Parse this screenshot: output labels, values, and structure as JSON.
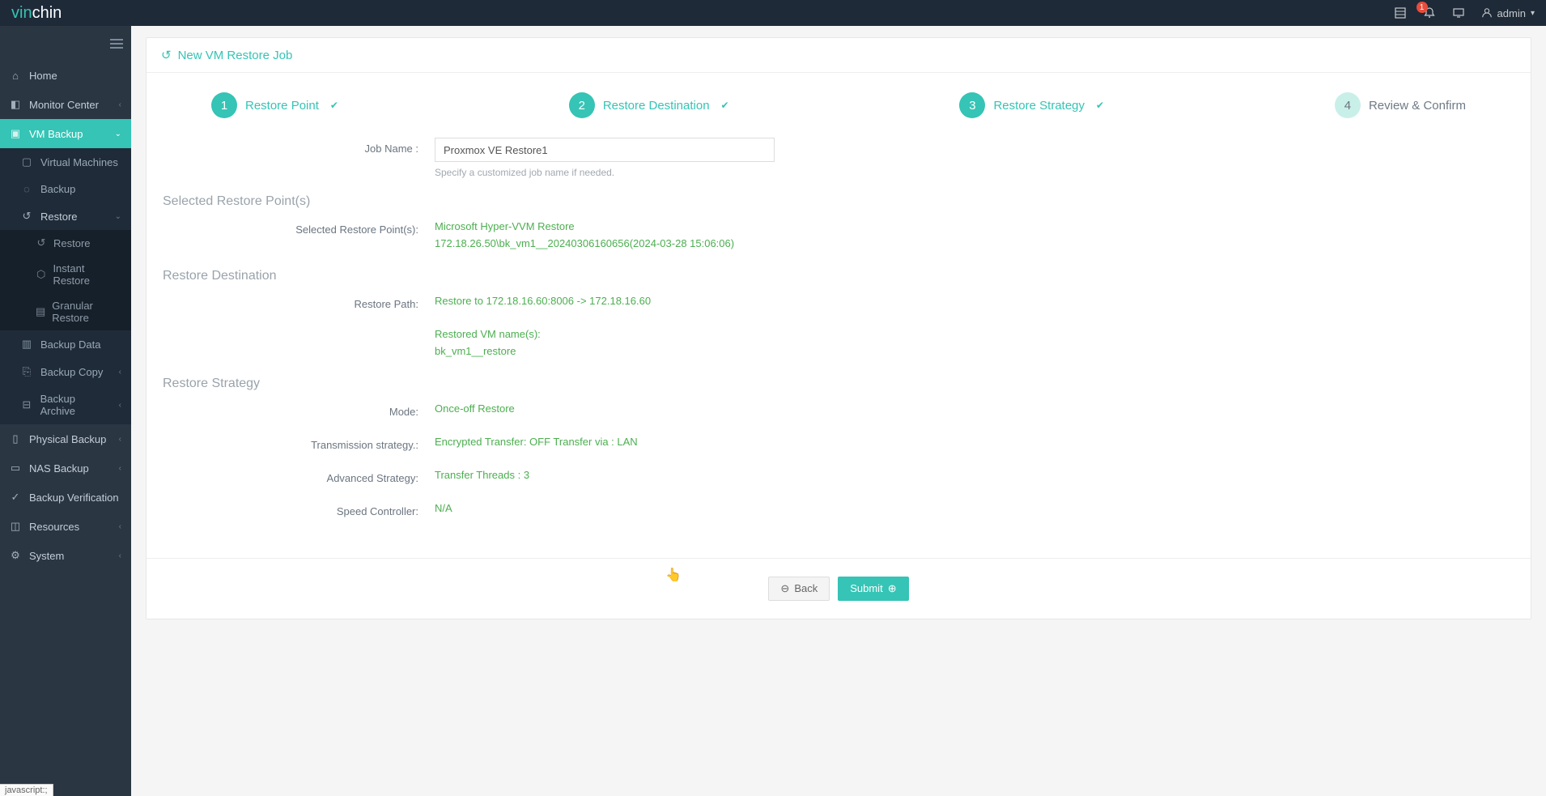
{
  "topbar": {
    "logo_part1": "vin",
    "logo_part2": "chin",
    "notif_count": "1",
    "user_label": "admin"
  },
  "sidebar": {
    "items": [
      {
        "label": "Home"
      },
      {
        "label": "Monitor Center"
      },
      {
        "label": "VM Backup",
        "active": true
      },
      {
        "label": "Physical Backup"
      },
      {
        "label": "NAS Backup"
      },
      {
        "label": "Backup Verification"
      },
      {
        "label": "Resources"
      },
      {
        "label": "System"
      }
    ],
    "vmbackup_sub": [
      {
        "label": "Virtual Machines"
      },
      {
        "label": "Backup"
      },
      {
        "label": "Restore",
        "expanded": true
      },
      {
        "label": "Backup Data"
      },
      {
        "label": "Backup Copy"
      },
      {
        "label": "Backup Archive"
      }
    ],
    "restore_sub": [
      {
        "label": "Restore"
      },
      {
        "label": "Instant Restore"
      },
      {
        "label": "Granular Restore"
      }
    ]
  },
  "page": {
    "title": "New VM Restore Job",
    "steps": [
      {
        "num": "1",
        "label": "Restore Point"
      },
      {
        "num": "2",
        "label": "Restore Destination"
      },
      {
        "num": "3",
        "label": "Restore Strategy"
      },
      {
        "num": "4",
        "label": "Review & Confirm"
      }
    ],
    "job_name_label": "Job Name :",
    "job_name_value": "Proxmox VE Restore1",
    "job_name_helper": "Specify a customized job name if needed.",
    "section_restore_points": "Selected Restore Point(s)",
    "selected_restore_points_label": "Selected Restore Point(s):",
    "selected_restore_points_val1": "Microsoft Hyper-VVM Restore",
    "selected_restore_points_val2": "172.18.26.50\\bk_vm1__20240306160656(2024-03-28 15:06:06)",
    "section_restore_dest": "Restore Destination",
    "restore_path_label": "Restore Path:",
    "restore_path_val": "Restore to 172.18.16.60:8006 -> 172.18.16.60",
    "restored_vm_names_label": "Restored VM name(s):",
    "restored_vm_names_val": "bk_vm1__restore",
    "section_restore_strategy": "Restore Strategy",
    "mode_label": "Mode:",
    "mode_val": "Once-off Restore",
    "transmission_label": "Transmission strategy.:",
    "transmission_val": "Encrypted Transfer: OFF Transfer via : LAN",
    "advanced_label": "Advanced Strategy:",
    "advanced_val": "Transfer Threads : 3",
    "speed_label": "Speed Controller:",
    "speed_val": "N/A",
    "back_btn": "Back",
    "submit_btn": "Submit"
  },
  "status_tip": "javascript:;"
}
